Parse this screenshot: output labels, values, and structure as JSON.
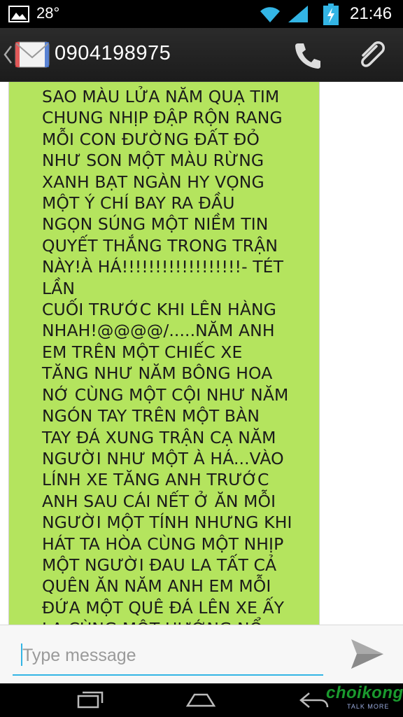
{
  "status_bar": {
    "temperature": "28°",
    "time": "21:46",
    "icons": [
      "picture-icon",
      "wifi-icon",
      "signal-icon",
      "battery-charging-icon"
    ]
  },
  "action_bar": {
    "title": "0904198975",
    "icons": [
      "back-chevron-icon",
      "envelope-icon",
      "phone-icon",
      "paperclip-icon"
    ]
  },
  "message": {
    "text": "SAO MÀU LỬA NĂM QUẠ TIM\nCHUNG NHỊP ĐẬP RỘN RANG\nMỖI CON ĐƯỜNG ĐẤT ĐỎ\nNHƯ SON MỘT MÀU RỪNG\nXANH BẠT NGÀN HY VỌNG\nMỘT Ý CHÍ BAY RA ĐẦU\nNGỌN SÚNG MỘT NIỀM TIN\nQUYẾT THẮNG TRONG TRẬN\nNÀY!À HÁ!!!!!!!!!!!!!!!!!!- TÉT LẦN\nCUỐI TRƯỚC KHI LÊN HÀNG\nNHAH!@@@@/.....NĂM ANH\nEM TRÊN MỘT CHIẾC XE\nTĂNG NHƯ NĂM BÔNG HOA\nNỚ CÙNG MỘT CỘI NHƯ NĂM\nNGÓN TAY TRÊN MỘT BÀN\nTAY ĐÁ XUNG TRẬN CẠ NĂM\nNGƯỜI NHƯ MỘT À HÁ...VÀO\nLÍNH XE TĂNG ANH TRƯỚC\nANH SAU CÁI NẾT Ở ĂN MỖI\nNGƯỜI MỘT TÍNH NHƯNG KHI\nHÁT TA HÒA CÙNG MỘT NHỊP\nMỘT NGƯỜI ĐAU LA TẤT CẢ\nQUÊN ĂN NĂM ANH EM MỖI\nĐỨA MỘT QUÊ ĐÁ LÊN XE ẤY\nLA CÙNG MỘT HƯỚNG NỔ\nMÁY LÊN LA MỘT DA XUNG",
    "bubble_color": "#b4e45e"
  },
  "compose": {
    "placeholder": "Type message",
    "value": "",
    "accent": "#33b5e5"
  },
  "nav_bar": {
    "buttons": [
      "recent-apps-icon",
      "home-icon",
      "back-icon"
    ]
  },
  "watermark": {
    "brand": "choikong",
    "tagline": "TALK MORE"
  }
}
